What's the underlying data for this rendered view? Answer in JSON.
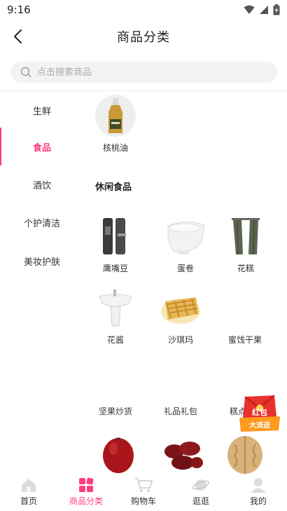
{
  "status": {
    "time": "9:16"
  },
  "header": {
    "title": "商品分类"
  },
  "search": {
    "placeholder": "点击搜索商品"
  },
  "sidebar": {
    "items": [
      {
        "label": "生鲜"
      },
      {
        "label": "食品",
        "active": true
      },
      {
        "label": "酒饮"
      },
      {
        "label": "个护清洁"
      },
      {
        "label": "美妆护肤"
      }
    ]
  },
  "content": {
    "top_product": {
      "label": "核桃油"
    },
    "section_title": "休闲食品",
    "products": [
      {
        "label": "鹰嘴豆",
        "icon": "door-lock-image"
      },
      {
        "label": "蛋卷",
        "icon": "toilet-image"
      },
      {
        "label": "花糕",
        "icon": "curtain-image"
      },
      {
        "label": "花酱",
        "icon": "basin-image"
      },
      {
        "label": "沙琪玛",
        "icon": "pastry-image"
      },
      {
        "label": "蜜饯干果",
        "icon": ""
      },
      {
        "label": "坚果炒货",
        "icon": "red-date-image"
      },
      {
        "label": "礼品礼包",
        "icon": "dates-image"
      },
      {
        "label": "糕点",
        "icon": "walnut-image"
      }
    ]
  },
  "badge": {
    "line1": "红包",
    "line2": "大派送"
  },
  "tabbar": {
    "items": [
      {
        "label": "首页",
        "icon": "home-icon"
      },
      {
        "label": "商品分类",
        "icon": "category-icon",
        "active": true
      },
      {
        "label": "购物车",
        "icon": "cart-icon"
      },
      {
        "label": "逛逛",
        "icon": "planet-icon"
      },
      {
        "label": "我的",
        "icon": "user-icon"
      }
    ]
  },
  "colors": {
    "accent": "#ff3d7f",
    "text": "#333333",
    "search_bg": "#f3f3f3"
  }
}
